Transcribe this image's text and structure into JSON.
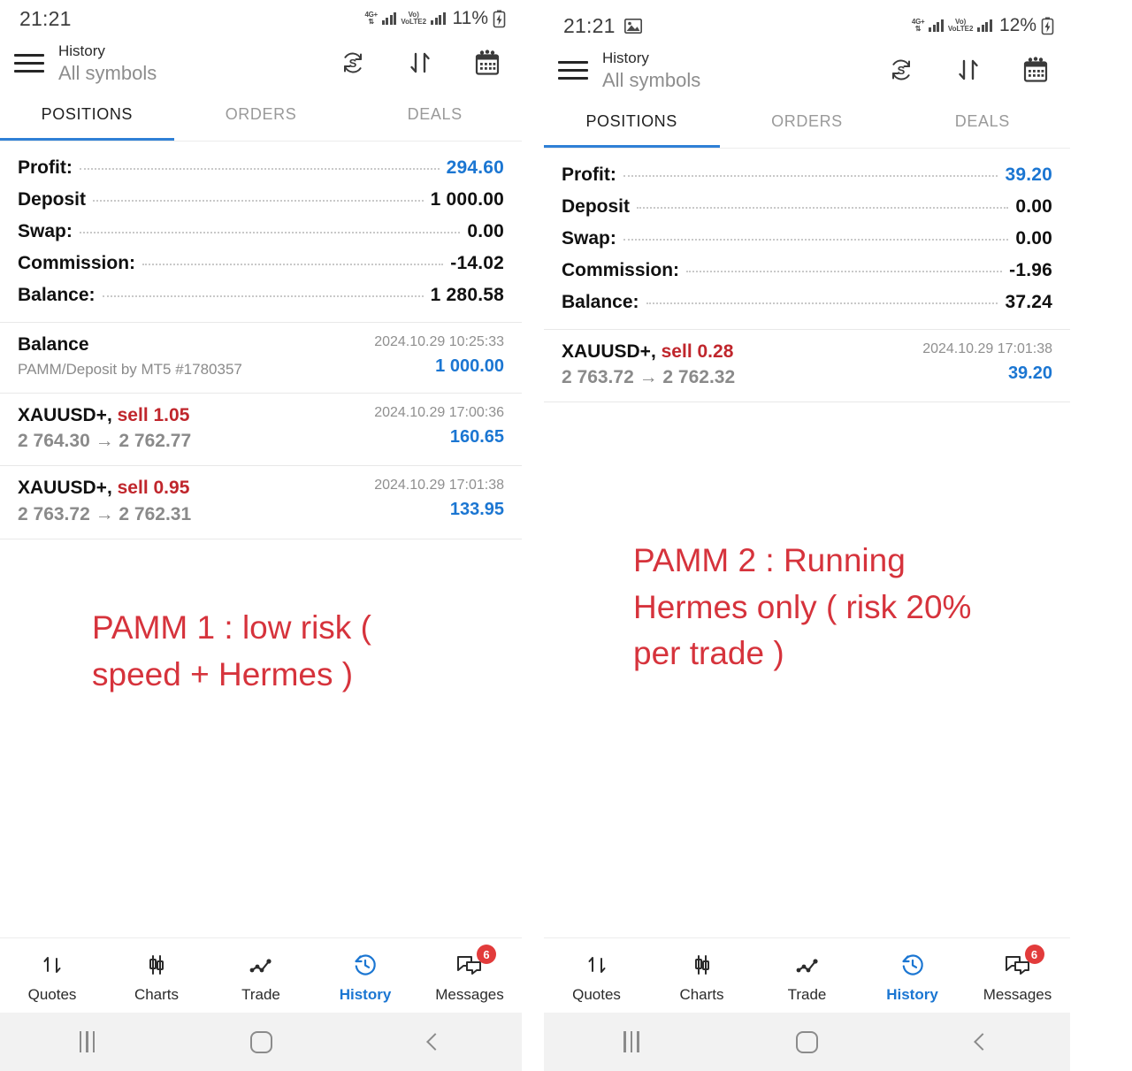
{
  "panels": [
    {
      "id": "pamm1",
      "statusbar": {
        "time": "21:21",
        "network": "4G+",
        "volte": "VoLTE2",
        "battery": "11%",
        "screenshot_icon": false
      },
      "header": {
        "title": "History",
        "subtitle": "All symbols",
        "icons": [
          "currency-refresh-icon",
          "sort-icon",
          "calendar-icon"
        ]
      },
      "tabs": [
        {
          "label": "POSITIONS",
          "active": true
        },
        {
          "label": "ORDERS",
          "active": false
        },
        {
          "label": "DEALS",
          "active": false
        }
      ],
      "summary": [
        {
          "label": "Profit:",
          "value": "294.60",
          "accent": true
        },
        {
          "label": "Deposit",
          "value": "1 000.00",
          "accent": false
        },
        {
          "label": "Swap:",
          "value": "0.00",
          "accent": false
        },
        {
          "label": "Commission:",
          "value": "-14.02",
          "accent": false
        },
        {
          "label": "Balance:",
          "value": "1 280.58",
          "accent": false
        }
      ],
      "deals": [
        {
          "type": "balance",
          "symbol": "Balance",
          "side": "",
          "volume": "",
          "subtitle": "PAMM/Deposit by MT5 #1780357",
          "prices": "",
          "time": "2024.10.29 10:25:33",
          "amount": "1 000.00"
        },
        {
          "type": "trade",
          "symbol": "XAUUSD+,",
          "side": "sell",
          "volume": "1.05",
          "subtitle": "",
          "prices": "2 764.30 → 2 762.77",
          "time": "2024.10.29 17:00:36",
          "amount": "160.65"
        },
        {
          "type": "trade",
          "symbol": "XAUUSD+,",
          "side": "sell",
          "volume": "0.95",
          "subtitle": "",
          "prices": "2 763.72 → 2 762.31",
          "time": "2024.10.29 17:01:38",
          "amount": "133.95"
        }
      ],
      "annotation": "PAMM 1 : low risk ( speed + Hermes )",
      "bottom_nav": [
        {
          "label": "Quotes",
          "icon": "quotes-arrows-icon",
          "active": false,
          "badge": ""
        },
        {
          "label": "Charts",
          "icon": "candlestick-icon",
          "active": false,
          "badge": ""
        },
        {
          "label": "Trade",
          "icon": "trade-line-icon",
          "active": false,
          "badge": ""
        },
        {
          "label": "History",
          "icon": "history-clock-icon",
          "active": true,
          "badge": ""
        },
        {
          "label": "Messages",
          "icon": "messages-chat-icon",
          "active": false,
          "badge": "6"
        }
      ]
    },
    {
      "id": "pamm2",
      "statusbar": {
        "time": "21:21",
        "network": "4G+",
        "volte": "VoLTE2",
        "battery": "12%",
        "screenshot_icon": true
      },
      "header": {
        "title": "History",
        "subtitle": "All symbols",
        "icons": [
          "currency-refresh-icon",
          "sort-icon",
          "calendar-icon"
        ]
      },
      "tabs": [
        {
          "label": "POSITIONS",
          "active": true
        },
        {
          "label": "ORDERS",
          "active": false
        },
        {
          "label": "DEALS",
          "active": false
        }
      ],
      "summary": [
        {
          "label": "Profit:",
          "value": "39.20",
          "accent": true
        },
        {
          "label": "Deposit",
          "value": "0.00",
          "accent": false
        },
        {
          "label": "Swap:",
          "value": "0.00",
          "accent": false
        },
        {
          "label": "Commission:",
          "value": "-1.96",
          "accent": false
        },
        {
          "label": "Balance:",
          "value": "37.24",
          "accent": false
        }
      ],
      "deals": [
        {
          "type": "trade",
          "symbol": "XAUUSD+,",
          "side": "sell",
          "volume": "0.28",
          "subtitle": "",
          "prices": "2 763.72 → 2 762.32",
          "time": "2024.10.29 17:01:38",
          "amount": "39.20"
        }
      ],
      "annotation": "PAMM 2 : Running Hermes only ( risk 20% per trade )",
      "bottom_nav": [
        {
          "label": "Quotes",
          "icon": "quotes-arrows-icon",
          "active": false,
          "badge": ""
        },
        {
          "label": "Charts",
          "icon": "candlestick-icon",
          "active": false,
          "badge": ""
        },
        {
          "label": "Trade",
          "icon": "trade-line-icon",
          "active": false,
          "badge": ""
        },
        {
          "label": "History",
          "icon": "history-clock-icon",
          "active": true,
          "badge": ""
        },
        {
          "label": "Messages",
          "icon": "messages-chat-icon",
          "active": false,
          "badge": "6"
        }
      ]
    }
  ],
  "android_nav": {
    "recents": "recents-icon",
    "home": "home-icon",
    "back": "back-icon"
  },
  "colors": {
    "accent_blue": "#1b76d2",
    "sell_red": "#c0262c",
    "annotation_red": "#d6333c",
    "badge_red": "#e23b3b",
    "tab_underline": "#2f80d6"
  }
}
